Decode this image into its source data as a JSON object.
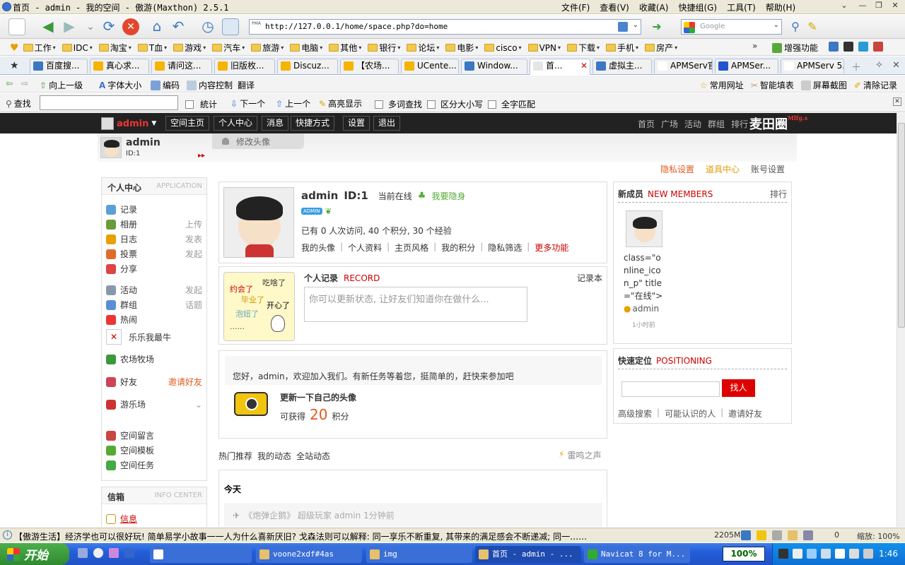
{
  "window": {
    "title": "首页 - admin - 我的空间 - 傲游(Maxthon) 2.5.1"
  },
  "menu": [
    "文件(F)",
    "查看(V)",
    "收藏(A)",
    "快捷组(G)",
    "工具(T)",
    "帮助(H)"
  ],
  "address": {
    "url": "http://127.0.0.1/home/space.php?do=home",
    "badge": "PMA"
  },
  "search": {
    "placeholder": "Google"
  },
  "favorites": [
    "工作",
    "IDC",
    "淘宝",
    "T血",
    "游戏",
    "汽车",
    "旅游",
    "电脑",
    "其他",
    "银行",
    "论坛",
    "电影",
    "cisco",
    "VPN",
    "下载",
    "手机",
    "房产"
  ],
  "favorites_extra": "增强功能",
  "tabs": [
    "百度搜...",
    "真心求...",
    "请问这...",
    "旧版枚...",
    "Discuz...",
    "【农场...",
    "UCente...",
    "Window...",
    "首...",
    "虚拟主...",
    "APMServ官...",
    "APMSer...",
    "APMServ 5..."
  ],
  "navbar2": {
    "up": "向上一级",
    "font": "字体大小",
    "encoding": "编码",
    "content_ctrl": "内容控制",
    "translate": "翻译",
    "right": [
      "常用网址",
      "智能填表",
      "屏幕截图",
      "清除记录"
    ]
  },
  "findbar": {
    "label": "查找",
    "stat": "統计",
    "next": "下一个",
    "prev": "上一个",
    "highlight": "高亮显示",
    "multi": "多词查找",
    "case": "区分大小写",
    "whole": "全字匹配"
  },
  "site": {
    "user": "admin",
    "nav": [
      "空间主页",
      "个人中心",
      "消息",
      "快捷方式",
      "设置",
      "退出"
    ],
    "rlinks": [
      "首页",
      "广场",
      "活动",
      "群组",
      "排行"
    ],
    "brand": "麦田圈",
    "brand_sub": "Mlfg.s",
    "header_user": "admin",
    "header_id": "ID:1",
    "change_avatar": "修改头像",
    "top_links": [
      "隐私设置",
      "道具中心",
      "账号设置"
    ]
  },
  "left": {
    "title": "个人中心",
    "title_en": "APPLICATION",
    "items": [
      {
        "label": "记录",
        "right": ""
      },
      {
        "label": "相册",
        "right": "上传"
      },
      {
        "label": "日志",
        "right": "发表"
      },
      {
        "label": "投票",
        "right": "发起"
      },
      {
        "label": "分享",
        "right": ""
      },
      {
        "label": "活动",
        "right": "发起"
      },
      {
        "label": "群组",
        "right": "话题"
      },
      {
        "label": "热闹",
        "right": ""
      },
      {
        "label": "乐乐我最牛",
        "right": ""
      },
      {
        "label": "农场牧场",
        "right": ""
      },
      {
        "label": "好友",
        "right": "邀请好友"
      },
      {
        "label": "游乐场",
        "right": ""
      },
      {
        "label": "空间留言",
        "right": ""
      },
      {
        "label": "空间模板",
        "right": ""
      },
      {
        "label": "空间任务",
        "right": ""
      }
    ],
    "info_title": "信箱",
    "info_title_en": "INFO CENTER",
    "info_item": "信息"
  },
  "profile": {
    "name": "admin",
    "id": "ID:1",
    "online": "当前在线",
    "invisible": "我要隐身",
    "badge": "ADMIN",
    "stats": "已有 0 人次访问, 40 个积分, 30 个经验",
    "links": [
      "我的头像",
      "个人资料",
      "主页风格",
      "我的积分",
      "隐私筛选",
      "更多功能"
    ]
  },
  "record": {
    "title": "个人记录",
    "title_en": "RECORD",
    "book": "记录本",
    "placeholder": "你可以更新状态, 让好友们知道你在做什么...",
    "moods": [
      "约会了",
      "吃啥了",
      "毕业了",
      "开心了",
      "泡妞了",
      "......"
    ]
  },
  "task": {
    "welcome": "您好，admin，欢迎加入我们。有新任务等着您，挺简单的，赶快来参加吧",
    "title": "更新一下自己的头像",
    "reward_pre": "可获得",
    "reward_num": "20",
    "reward_post": "积分"
  },
  "feed": {
    "tabs": [
      "热门推荐",
      "我的动态",
      "全站动态"
    ],
    "right": "雷鸣之声",
    "today": "今天",
    "item": "《炮弹企鹅》 超级玩家 admin 1分钟前"
  },
  "members": {
    "title": "新成员",
    "title_en": "NEW MEMBERS",
    "rank": "排行",
    "code": "class=\"o nline_ico n_p\" title =\"在线\">",
    "name": "admin",
    "time": "1小时前"
  },
  "position": {
    "title": "快速定位",
    "title_en": "POSITIONING",
    "button": "找人",
    "links": [
      "高级搜索",
      "可能认识的人",
      "邀请好友"
    ]
  },
  "statusbar": {
    "news": "【傲游生活】经济学也可以很好玩! 简单易学小故事一一人为什么喜新厌旧? 戈森法则可以解释: 同一享乐不断重复, 其带来的满足感会不断递减; 同一……",
    "mem": "2205M",
    "count": "0",
    "zoom": "缩放: 100%"
  },
  "taskbar": {
    "start": "开始",
    "items": [
      "voone2xdf#4as",
      "img",
      "首页 - admin - ...",
      "Navicat 8 for M..."
    ],
    "lang": "100%",
    "clock": "1:46"
  }
}
